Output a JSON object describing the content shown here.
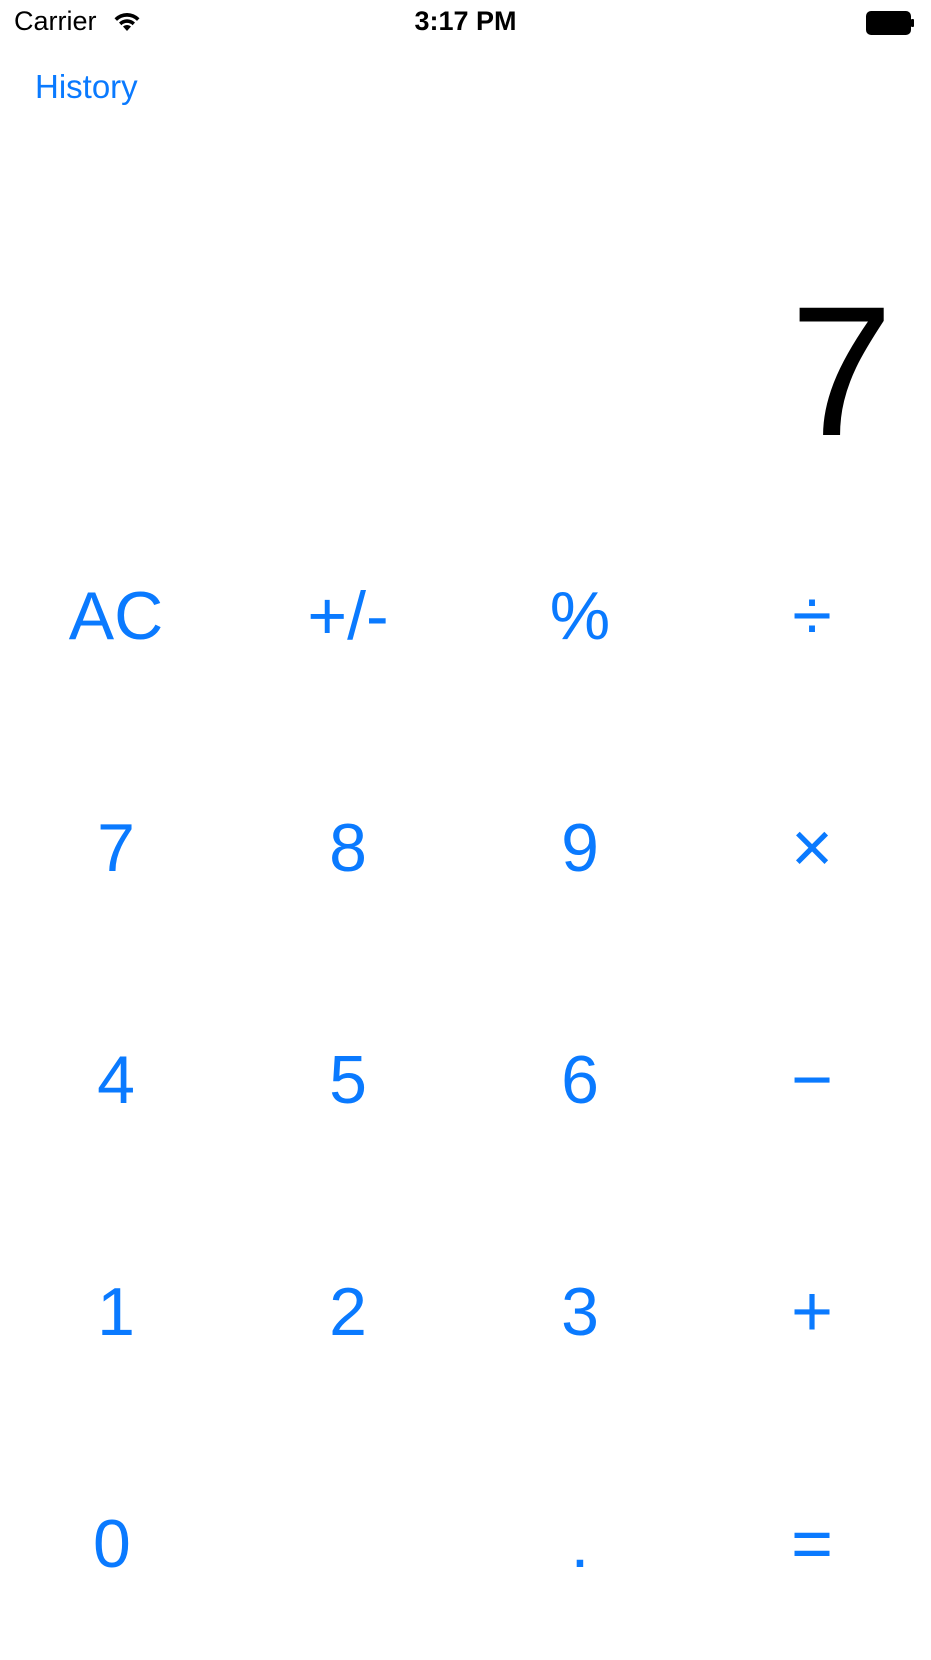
{
  "status_bar": {
    "carrier": "Carrier",
    "time": "3:17 PM",
    "wifi_icon": "wifi-icon",
    "battery_icon": "battery-icon"
  },
  "nav": {
    "history_label": "History"
  },
  "display": {
    "value": "7"
  },
  "accent_color": "#0a7aff",
  "keys": {
    "row1": [
      "AC",
      "+/-",
      "%",
      "÷"
    ],
    "row2": [
      "7",
      "8",
      "9",
      "×"
    ],
    "row3": [
      "4",
      "5",
      "6",
      "−"
    ],
    "row4": [
      "1",
      "2",
      "3",
      "+"
    ],
    "row5": [
      "0",
      "",
      ".",
      "="
    ]
  }
}
